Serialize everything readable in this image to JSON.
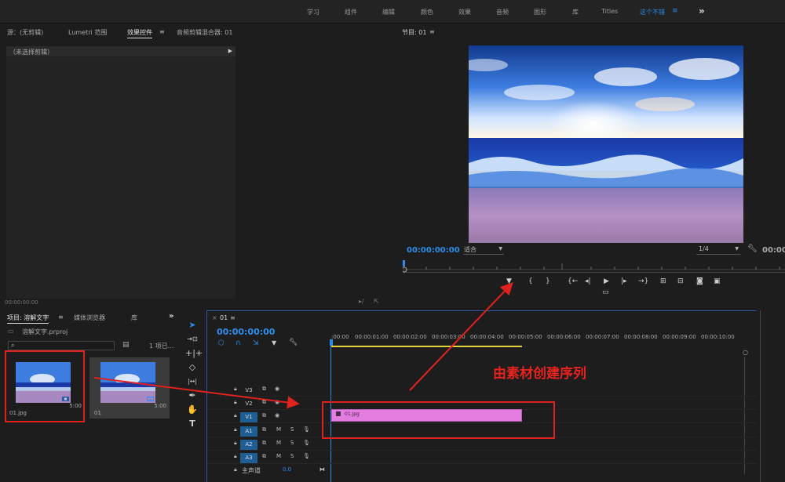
{
  "workspaces": {
    "items": [
      "学习",
      "组件",
      "编辑",
      "颜色",
      "效果",
      "音频",
      "图形",
      "库",
      "Titles",
      "这个不错"
    ],
    "menu_icon": "≡",
    "more_label": "»"
  },
  "source_panel": {
    "tabs": [
      "源：(无剪辑)",
      "Lumetri 范围",
      "效果控件",
      "音频剪辑混合器: 01"
    ],
    "sub_label": "（未选择剪辑）",
    "timecode": "00:00:00:00"
  },
  "program_panel": {
    "tab": "节目: 01",
    "timecode": "00:00:00:00",
    "fit_label": "适合",
    "resolution": "1/4",
    "duration": "00:00"
  },
  "project_panel": {
    "tabs": [
      "项目: 溶解文字",
      "媒体浏览器",
      "库"
    ],
    "file": "溶解文字.prproj",
    "search_placeholder": "",
    "count": "1 项已...",
    "items": [
      {
        "name": "01.jpg",
        "duration": "5:00"
      },
      {
        "name": "01",
        "duration": "5:00"
      }
    ]
  },
  "tools": [
    "selection-tool",
    "track-select-tool",
    "ripple-edit-tool",
    "razor-tool",
    "slip-tool",
    "pen-tool",
    "hand-tool",
    "type-tool"
  ],
  "timeline": {
    "tab": "01",
    "timecode": "00:00:00:00",
    "ruler": [
      ":00:00",
      "00:00:01:00",
      "00:00:02:00",
      "00:00:03:00",
      "00:00:04:00",
      "00:00:05:00",
      "00:00:06:00",
      "00:00:07:00",
      "00:00:08:00",
      "00:00:09:00",
      "00:00:10:00"
    ],
    "video_tracks": [
      "V3",
      "V2",
      "V1"
    ],
    "audio_tracks": [
      "A1",
      "A2",
      "A3"
    ],
    "master_label": "主声道",
    "master_value": "0.0",
    "clip_name": "01.jpg"
  },
  "annotation": {
    "text": "由素材创建序列",
    "color": "#e8231f"
  },
  "colors": {
    "accent": "#2d8ceb",
    "clip": "#e37ee0",
    "work_area": "#e3d23a"
  }
}
